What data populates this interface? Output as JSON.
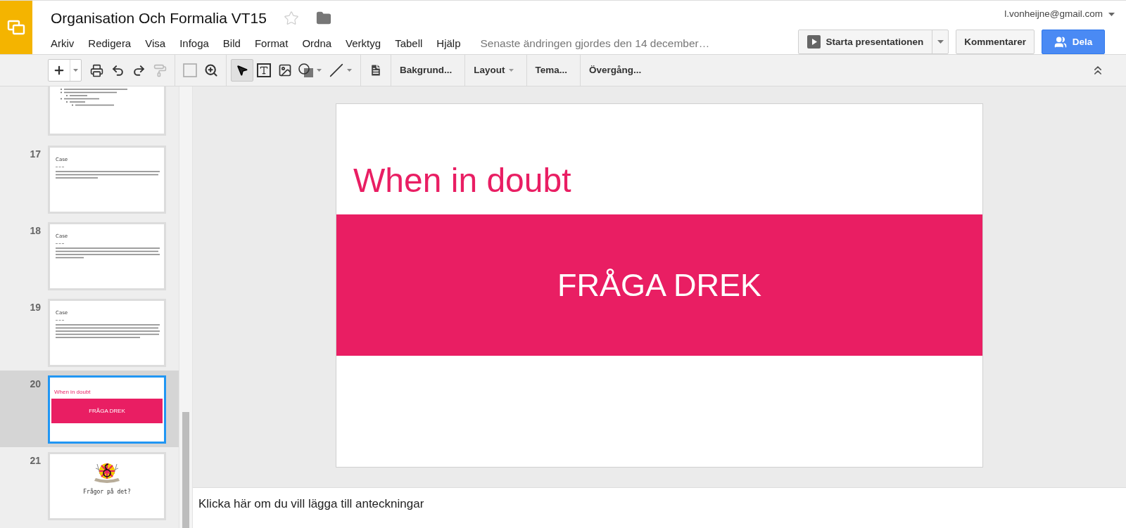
{
  "header": {
    "title": "Organisation Och Formalia VT15",
    "starred": false,
    "account": "l.vonheijne@gmail.com",
    "menu": [
      "Arkiv",
      "Redigera",
      "Visa",
      "Infoga",
      "Bild",
      "Format",
      "Ordna",
      "Verktyg",
      "Tabell",
      "Hjälp"
    ],
    "last_edit": "Senaste ändringen gjordes den 14 december…",
    "present_button": "Starta presentationen",
    "comments_button": "Kommentarer",
    "share_button": "Dela"
  },
  "toolbar": {
    "text_buttons": [
      {
        "label": "Bakgrund...",
        "dropdown": false
      },
      {
        "label": "Layout",
        "dropdown": true
      },
      {
        "label": "Tema...",
        "dropdown": false
      },
      {
        "label": "Övergång...",
        "dropdown": false
      }
    ]
  },
  "slides": [
    {
      "kind": "partial",
      "selected": false
    },
    {
      "kind": "text",
      "number": "17",
      "selected": false,
      "title": "Case"
    },
    {
      "kind": "text",
      "number": "18",
      "selected": false,
      "title": "Case"
    },
    {
      "kind": "text",
      "number": "19",
      "selected": false,
      "title": "Case"
    },
    {
      "kind": "band",
      "number": "20",
      "selected": true,
      "title": "When in doubt",
      "band_text": "FRÅGA DREK"
    },
    {
      "kind": "logo",
      "number": "21",
      "selected": false,
      "caption": "Frågor på det?"
    }
  ],
  "current_slide": {
    "title": "When in doubt",
    "band_text": "FRÅGA DREK"
  },
  "notes": {
    "placeholder": "Klicka här om du vill lägga till anteckningar"
  }
}
